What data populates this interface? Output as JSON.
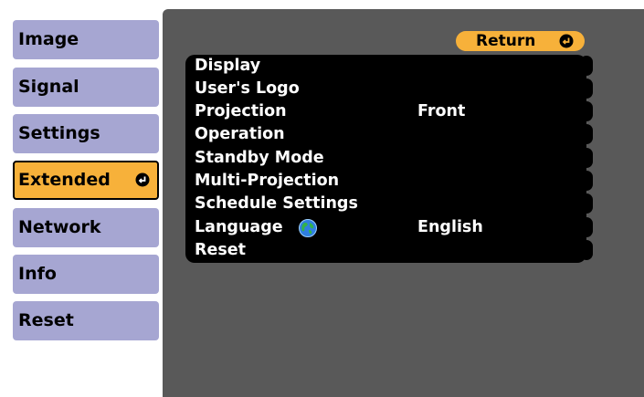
{
  "tabs": [
    {
      "label": "Image"
    },
    {
      "label": "Signal"
    },
    {
      "label": "Settings"
    },
    {
      "label": "Extended",
      "selected": true
    },
    {
      "label": "Network"
    },
    {
      "label": "Info"
    },
    {
      "label": "Reset"
    }
  ],
  "return_button": {
    "label": "Return"
  },
  "menu": [
    {
      "label": "Display",
      "value": ""
    },
    {
      "label": "User's Logo",
      "value": ""
    },
    {
      "label": "Projection",
      "value": "Front"
    },
    {
      "label": "Operation",
      "value": ""
    },
    {
      "label": "Standby Mode",
      "value": ""
    },
    {
      "label": "Multi-Projection",
      "value": ""
    },
    {
      "label": "Schedule Settings",
      "value": ""
    },
    {
      "label": "Language",
      "value": "English",
      "icon": "globe-icon"
    },
    {
      "label": "Reset",
      "value": ""
    }
  ],
  "colors": {
    "tab": "#a6a6d2",
    "active_tab": "#f7b13a",
    "panel": "#595959",
    "menu_bg": "#000000",
    "menu_text": "#ffffff"
  }
}
